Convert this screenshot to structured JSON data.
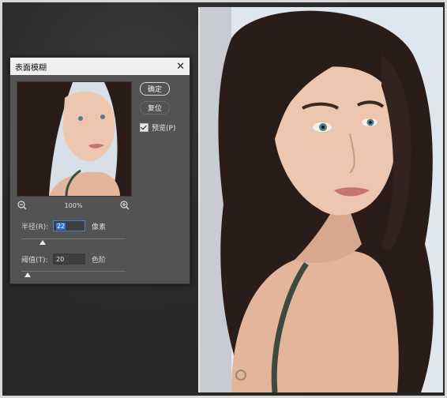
{
  "dialog": {
    "title": "表面模糊",
    "ok_label": "确定",
    "reset_label": "复位",
    "preview_label": "预览(P)",
    "preview_checked": true,
    "zoom_level": "100%",
    "radius": {
      "label": "半径(R):",
      "value": "22",
      "unit": "像素"
    },
    "threshold": {
      "label": "阈值(T):",
      "value": "20",
      "unit": "色阶"
    }
  },
  "icons": {
    "close": "close-icon",
    "zoom_out": "zoom-out-icon",
    "zoom_in": "zoom-in-icon",
    "checkbox": "checkbox-checked-icon"
  },
  "colors": {
    "workspace": "#2b2b2b",
    "dialog": "#535353",
    "photo_bg": "#dfe6ee",
    "selection": "#2f6fe0"
  }
}
